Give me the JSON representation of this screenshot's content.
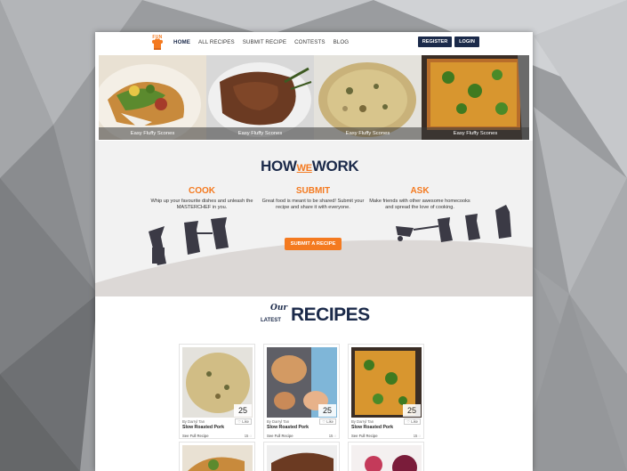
{
  "brand": {
    "logo_text": "FUN",
    "accent": "#f47a20",
    "navy": "#1b2a4a"
  },
  "nav": {
    "links": [
      "HOME",
      "ALL RECIPES",
      "SUBMIT RECIPE",
      "CONTESTS",
      "BLOG"
    ],
    "register": "REGISTER",
    "login": "LOGIN"
  },
  "hero": {
    "slides": [
      "Easy Fluffy Scones",
      "Easy Fluffy Scones",
      "Easy Fluffy Scones",
      "Easy Fluffy Scones"
    ]
  },
  "how": {
    "title_left": "HOW",
    "title_mid": "WE",
    "title_right": "WORK",
    "steps": [
      {
        "heading": "COOK",
        "text": "Whip up your favourite dishes and unleash the MASTERCHEF in you."
      },
      {
        "heading": "SUBMIT",
        "text": "Great food is meant to be shared! Submit your recipe and share it with everyone."
      },
      {
        "heading": "ASK",
        "text": "Make friends with other awesome homecooks and spread the love of cooking."
      }
    ],
    "cta": "SUBMIT A RECIPE"
  },
  "latest": {
    "our": "Our",
    "latest": "LATEST",
    "recipes": "RECIPES",
    "cards": [
      {
        "num": "25",
        "author": "By Darryl Tan",
        "like": "♡ Like",
        "name": "Slow Roasted Pork",
        "link": "See Full Recipe",
        "count": "15 ◌"
      },
      {
        "num": "25",
        "author": "By Darryl Tan",
        "like": "♡ Like",
        "name": "Slow Roasted Pork",
        "link": "See Full Recipe",
        "count": "15 ◌"
      },
      {
        "num": "25",
        "author": "By Darryl Tan",
        "like": "♡ Like",
        "name": "Slow Roasted Pork",
        "link": "See Full Recipe",
        "count": "15 ◌"
      }
    ]
  }
}
